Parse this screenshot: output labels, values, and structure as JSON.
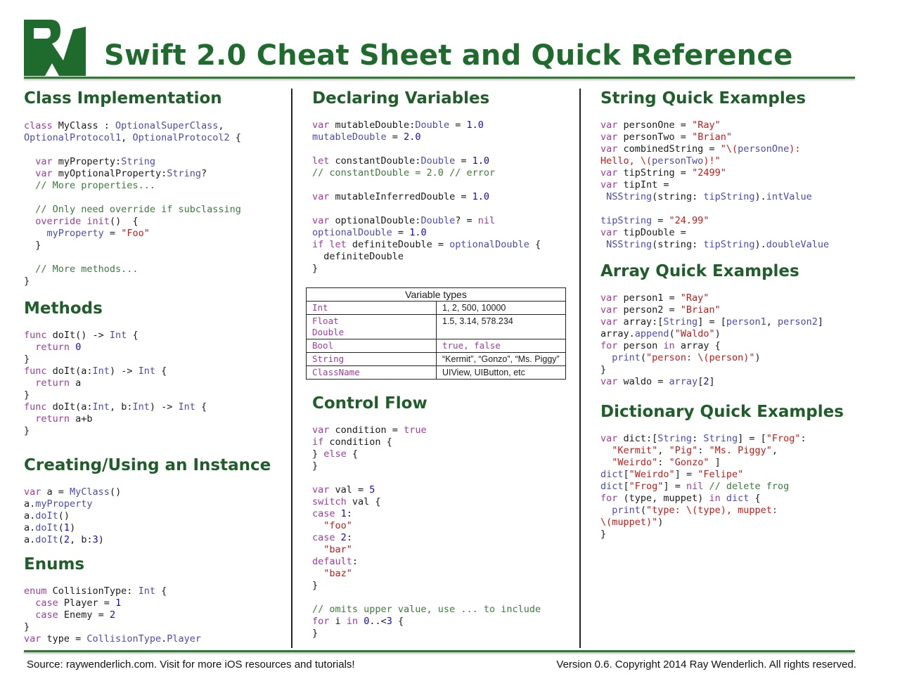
{
  "brand_color": "#1f6b2e",
  "logo": {
    "icon": "rw-logo-icon"
  },
  "title": "Swift 2.0 Cheat Sheet and Quick Reference",
  "sections": {
    "class_impl": "Class Implementation",
    "methods": "Methods",
    "instance": "Creating/Using an Instance",
    "enums": "Enums",
    "variables": "Declaring Variables",
    "control_flow": "Control Flow",
    "strings": "String Quick Examples",
    "arrays": "Array Quick Examples",
    "dicts": "Dictionary Quick Examples"
  },
  "var_table": {
    "title": "Variable types",
    "rows": [
      {
        "type": "Int",
        "example": "1, 2, 500, 10000"
      },
      {
        "type": "Float\nDouble",
        "example": "1.5, 3.14, 578.234"
      },
      {
        "type": "Bool",
        "example": "true, false"
      },
      {
        "type": "String",
        "example": "“Kermit”, “Gonzo”, “Ms. Piggy”"
      },
      {
        "type": "ClassName",
        "example": "UIView, UIButton, etc"
      }
    ]
  },
  "footer": {
    "left": "Source: raywenderlich.com. Visit for more iOS resources and tutorials!",
    "right": "Version 0.6. Copyright 2014 Ray Wenderlich. All rights reserved."
  }
}
